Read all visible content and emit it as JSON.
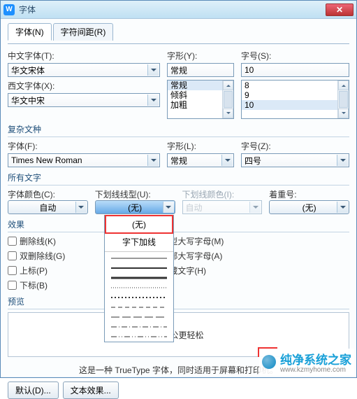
{
  "title": "字体",
  "tabs": {
    "font": "字体(N)",
    "spacing": "字符间距(R)"
  },
  "labels": {
    "cn_font": "中文字体(T):",
    "west_font": "西文字体(X):",
    "style": "字形(Y):",
    "size": "字号(S):",
    "complex_title": "复杂文种",
    "font_f": "字体(F):",
    "style_l": "字形(L):",
    "size_z": "字号(Z):",
    "all_text": "所有文字",
    "font_color": "字体颜色(C):",
    "underline_type": "下划线线型(U):",
    "underline_color": "下划线颜色(I):",
    "emphasis": "着重号:",
    "effects": "效果",
    "preview": "预览"
  },
  "values": {
    "cn_font": "华文宋体",
    "west_font": "华文中宋",
    "style_sel": "常规",
    "size_sel": "10",
    "font_f": "Times New Roman",
    "style_l": "常规",
    "size_z": "四号",
    "font_color": "自动",
    "underline": "(无)",
    "underline_color": "自动",
    "emphasis": "(无)",
    "preview_text": "上办公更轻松"
  },
  "list_style": [
    "常规",
    "倾斜",
    "加粗"
  ],
  "list_size": [
    "8",
    "9",
    "10"
  ],
  "checks": {
    "strike": "删除线(K)",
    "dbl_strike": "双删除线(G)",
    "super": "上标(P)",
    "sub": "下标(B)",
    "small_caps": "小型大写字母(M)",
    "all_caps": "全部大写字母(A)",
    "hidden": "隐藏文字(H)"
  },
  "dropdown": {
    "none": "(无)",
    "sub_line": "字下加线"
  },
  "info": "这是一种 TrueType 字体，同时适用于屏幕和打印机。",
  "buttons": {
    "default": "默认(D)...",
    "text_effect": "文本效果..."
  },
  "watermark": {
    "name": "纯净系统之家",
    "url": "www.kzmyhome.com"
  }
}
